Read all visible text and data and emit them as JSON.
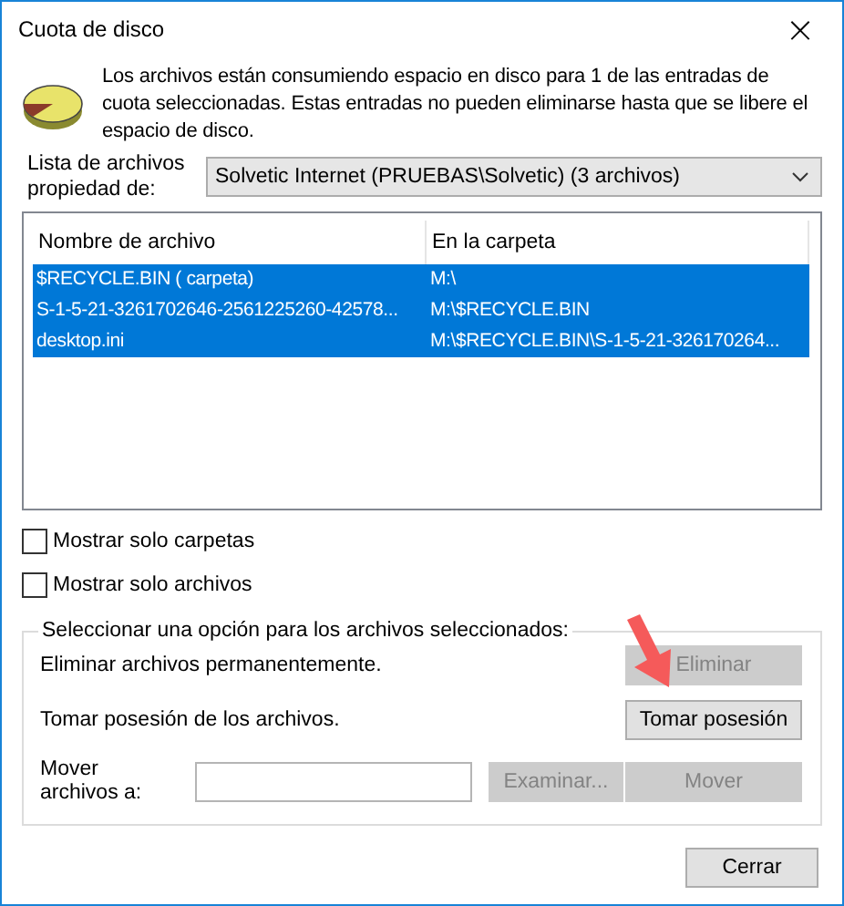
{
  "window": {
    "title": "Cuota de disco",
    "close": "×"
  },
  "message": "Los archivos están consumiendo espacio en disco para 1 de las entradas de cuota seleccionadas.  Estas entradas no pueden eliminarse hasta que se libere el espacio de disco.",
  "owner": {
    "label": "Lista de archivos propiedad de:",
    "value": "Solvetic Internet (PRUEBAS\\Solvetic) (3 archivos)"
  },
  "table": {
    "columns": [
      "Nombre de archivo",
      "En la carpeta"
    ],
    "rows": [
      {
        "cells": [
          "$RECYCLE.BIN  ( carpeta)",
          "M:\\"
        ],
        "selected": true
      },
      {
        "cells": [
          "S-1-5-21-3261702646-2561225260-42578...",
          "M:\\$RECYCLE.BIN"
        ],
        "selected": true
      },
      {
        "cells": [
          "desktop.ini",
          "M:\\$RECYCLE.BIN\\S-1-5-21-326170264..."
        ],
        "selected": true
      }
    ]
  },
  "checkboxes": [
    {
      "label": "Mostrar solo carpetas",
      "checked": false
    },
    {
      "label": "Mostrar solo archivos",
      "checked": false
    }
  ],
  "options": {
    "legend": "Seleccionar una opción para los archivos seleccionados:",
    "delete": {
      "label": "Eliminar archivos permanentemente.",
      "button": "Eliminar",
      "disabled": true
    },
    "take": {
      "label": "Tomar posesión de los archivos.",
      "button": "Tomar posesión",
      "disabled": false
    },
    "move": {
      "label": "Mover archivos a:",
      "browse": "Examinar...",
      "browse_disabled": true,
      "button": "Mover",
      "disabled": true
    }
  },
  "close_button": "Cerrar"
}
